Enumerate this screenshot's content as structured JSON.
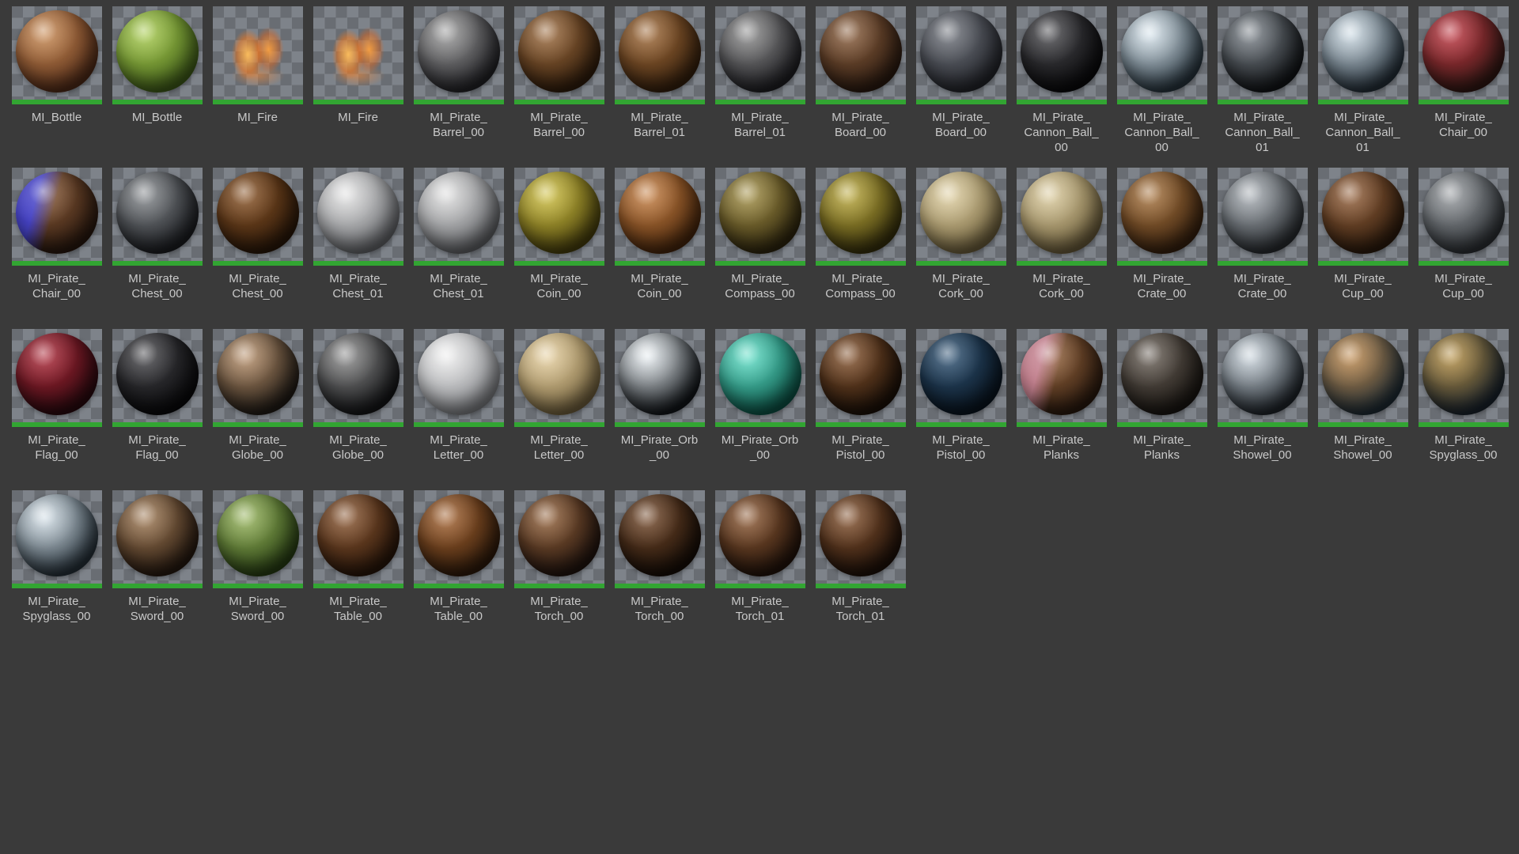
{
  "view": {
    "background": "#3a3a3a",
    "checker_light": "#7e838a",
    "checker_dark": "#696d73",
    "asset_type_bar_color": "#32a532",
    "label_color": "#c9c9c9"
  },
  "items": [
    {
      "label": "MI_Bottle",
      "kind": "sphere",
      "c1": "#c98a52",
      "c2": "#59301b"
    },
    {
      "label": "MI_Bottle",
      "kind": "sphere",
      "c1": "#a8cc4e",
      "c2": "#46651c"
    },
    {
      "label": "MI_Fire",
      "kind": "fire"
    },
    {
      "label": "MI_Fire",
      "kind": "fire"
    },
    {
      "label": "MI_Pirate_\nBarrel_00",
      "kind": "sphere",
      "c1": "#9a9a9a",
      "c2": "#26262a"
    },
    {
      "label": "MI_Pirate_\nBarrel_00",
      "kind": "sphere",
      "c1": "#9c6a3c",
      "c2": "#35200e"
    },
    {
      "label": "MI_Pirate_\nBarrel_01",
      "kind": "sphere",
      "c1": "#a06a38",
      "c2": "#3a230f"
    },
    {
      "label": "MI_Pirate_\nBarrel_01",
      "kind": "sphere",
      "c1": "#8c8c8c",
      "c2": "#222226"
    },
    {
      "label": "MI_Pirate_\nBoard_00",
      "kind": "sphere",
      "c1": "#8a5e3c",
      "c2": "#2f1d12"
    },
    {
      "label": "MI_Pirate_\nBoard_00",
      "kind": "sphere",
      "c1": "#70747c",
      "c2": "#26282e"
    },
    {
      "label": "MI_Pirate_\nCannon_Ball_\n00",
      "kind": "sphere",
      "c1": "#4a4a4e",
      "c2": "#0b0b0d"
    },
    {
      "label": "MI_Pirate_\nCannon_Ball_\n00",
      "kind": "sphere",
      "c1": "#d9e6ee",
      "c2": "#2c3a44"
    },
    {
      "label": "MI_Pirate_\nCannon_Ball_\n01",
      "kind": "sphere",
      "c1": "#7e858c",
      "c2": "#14171a"
    },
    {
      "label": "MI_Pirate_\nCannon_Ball_\n01",
      "kind": "sphere",
      "c1": "#cfdde6",
      "c2": "#28343e"
    },
    {
      "label": "MI_Pirate_\nChair_00",
      "kind": "sphere",
      "c1": "#c03540",
      "c2": "#361a16"
    },
    {
      "label": "MI_Pirate_\nChair_00",
      "kind": "sphere",
      "c1": "#8a5a36",
      "c2": "#2c1a10",
      "c3": "#4643c6"
    },
    {
      "label": "MI_Pirate_\nChest_00",
      "kind": "sphere",
      "c1": "#84888c",
      "c2": "#1e2024"
    },
    {
      "label": "MI_Pirate_\nChest_00",
      "kind": "sphere",
      "c1": "#8a5426",
      "c2": "#2e1a0a"
    },
    {
      "label": "MI_Pirate_\nChest_01",
      "kind": "sphere",
      "c1": "#e2e2e2",
      "c2": "#6e7074"
    },
    {
      "label": "MI_Pirate_\nChest_01",
      "kind": "sphere",
      "c1": "#dedede",
      "c2": "#6a6c70"
    },
    {
      "label": "MI_Pirate_\nCoin_00",
      "kind": "sphere",
      "c1": "#cfc040",
      "c2": "#4f460f"
    },
    {
      "label": "MI_Pirate_\nCoin_00",
      "kind": "sphere",
      "c1": "#c67f42",
      "c2": "#4e2a0e"
    },
    {
      "label": "MI_Pirate_\nCompass_00",
      "kind": "sphere",
      "c1": "#a39045",
      "c2": "#332a10"
    },
    {
      "label": "MI_Pirate_\nCompass_00",
      "kind": "sphere",
      "c1": "#baa83a",
      "c2": "#3c350e"
    },
    {
      "label": "MI_Pirate_\nCork_00",
      "kind": "sphere",
      "c1": "#e0d0a2",
      "c2": "#776842"
    },
    {
      "label": "MI_Pirate_\nCork_00",
      "kind": "sphere",
      "c1": "#dccc9e",
      "c2": "#736440"
    },
    {
      "label": "MI_Pirate_\nCrate_00",
      "kind": "sphere",
      "c1": "#a8743e",
      "c2": "#3c2410"
    },
    {
      "label": "MI_Pirate_\nCrate_00",
      "kind": "sphere",
      "c1": "#aab0b6",
      "c2": "#2c3034"
    },
    {
      "label": "MI_Pirate_\nCup_00",
      "kind": "sphere",
      "c1": "#94603a",
      "c2": "#301d0e"
    },
    {
      "label": "MI_Pirate_\nCup_00",
      "kind": "sphere",
      "c1": "#989ca0",
      "c2": "#303438"
    },
    {
      "label": "MI_Pirate_\nFlag_00",
      "kind": "sphere",
      "c1": "#ae2636",
      "c2": "#2e0a10"
    },
    {
      "label": "MI_Pirate_\nFlag_00",
      "kind": "sphere",
      "c1": "#46464a",
      "c2": "#0a0a0c"
    },
    {
      "label": "MI_Pirate_\nGlobe_00",
      "kind": "sphere",
      "c1": "#b8906a",
      "c2": "#241e18"
    },
    {
      "label": "MI_Pirate_\nGlobe_00",
      "kind": "sphere",
      "c1": "#8a8a8a",
      "c2": "#17181a"
    },
    {
      "label": "MI_Pirate_\nLetter_00",
      "kind": "sphere",
      "c1": "#eeeeee",
      "c2": "#8a8c90"
    },
    {
      "label": "MI_Pirate_\nLetter_00",
      "kind": "sphere",
      "c1": "#e6cf9e",
      "c2": "#7c6a44"
    },
    {
      "label": "MI_Pirate_Orb\n_00",
      "kind": "sphere",
      "c1": "#e8eef2",
      "c2": "#14181c"
    },
    {
      "label": "MI_Pirate_Orb\n_00",
      "kind": "sphere",
      "c1": "#5fe0c8",
      "c2": "#0e5a4c"
    },
    {
      "label": "MI_Pirate_\nPistol_00",
      "kind": "sphere",
      "c1": "#84522c",
      "c2": "#1e1209"
    },
    {
      "label": "MI_Pirate_\nPistol_00",
      "kind": "sphere",
      "c1": "#2f5374",
      "c2": "#0a1622"
    },
    {
      "label": "MI_Pirate_\nPlanks",
      "kind": "sphere",
      "c1": "#96643c",
      "c2": "#2e1c10",
      "c3": "#c3808e"
    },
    {
      "label": "MI_Pirate_\nPlanks",
      "kind": "sphere",
      "c1": "#6a6158",
      "c2": "#1c1814"
    },
    {
      "label": "MI_Pirate_\nShowel_00",
      "kind": "sphere",
      "c1": "#ccd6de",
      "c2": "#22282e"
    },
    {
      "label": "MI_Pirate_\nShowel_00",
      "kind": "sphere",
      "c1": "#c08a4c",
      "c2": "#223039"
    },
    {
      "label": "MI_Pirate_\nSpyglass_00",
      "kind": "sphere",
      "c1": "#b68f42",
      "c2": "#1c2630"
    },
    {
      "label": "MI_Pirate_\nSpyglass_00",
      "kind": "sphere",
      "c1": "#d4e0e8",
      "c2": "#2a363f"
    },
    {
      "label": "MI_Pirate_\nSword_00",
      "kind": "sphere",
      "c1": "#a07a54",
      "c2": "#2a1c12"
    },
    {
      "label": "MI_Pirate_\nSword_00",
      "kind": "sphere",
      "c1": "#96b45a",
      "c2": "#2c4416"
    },
    {
      "label": "MI_Pirate_\nTable_00",
      "kind": "sphere",
      "c1": "#8a5630",
      "c2": "#2c180b"
    },
    {
      "label": "MI_Pirate_\nTable_00",
      "kind": "sphere",
      "c1": "#a4622f",
      "c2": "#331d0c"
    },
    {
      "label": "MI_Pirate_\nTorch_00",
      "kind": "sphere",
      "c1": "#926038",
      "c2": "#241610"
    },
    {
      "label": "MI_Pirate_\nTorch_00",
      "kind": "sphere",
      "c1": "#74492a",
      "c2": "#190f08"
    },
    {
      "label": "MI_Pirate_\nTorch_01",
      "kind": "sphere",
      "c1": "#8e5a34",
      "c2": "#25150c"
    },
    {
      "label": "MI_Pirate_\nTorch_01",
      "kind": "sphere",
      "c1": "#84522e",
      "c2": "#20120a"
    }
  ]
}
